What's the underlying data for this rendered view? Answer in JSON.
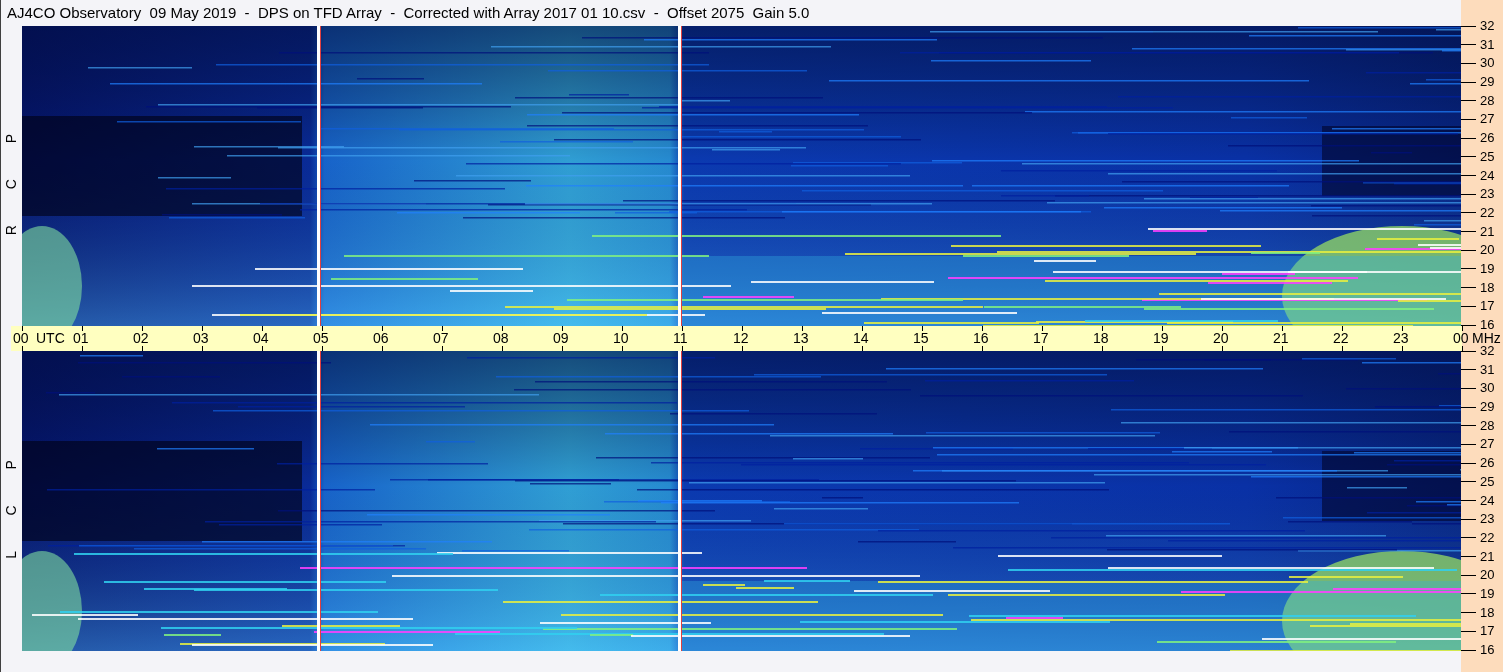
{
  "title": "AJ4CO Observatory  09 May 2019  -  DPS on TFD Array  -  Corrected with Array 2017 01 10.csv  -  Offset 2075  Gain 5.0",
  "panels": [
    {
      "label": "R C P",
      "frequency_ticks": [
        "32",
        "31",
        "30",
        "29",
        "28",
        "27",
        "26",
        "25",
        "24",
        "23",
        "22",
        "21",
        "20",
        "19",
        "18",
        "17",
        "16"
      ]
    },
    {
      "label": "L C P",
      "frequency_ticks": [
        "32",
        "31",
        "30",
        "29",
        "28",
        "27",
        "26",
        "25",
        "24",
        "23",
        "22",
        "21",
        "20",
        "19",
        "18",
        "17",
        "16"
      ]
    }
  ],
  "time_axis": {
    "ticks": [
      "00",
      "01",
      "02",
      "03",
      "04",
      "05",
      "06",
      "07",
      "08",
      "09",
      "10",
      "11",
      "12",
      "13",
      "14",
      "15",
      "16",
      "17",
      "18",
      "19",
      "20",
      "21",
      "22",
      "23",
      "00"
    ],
    "start_unit": "UTC",
    "end_unit": "MHz"
  }
}
